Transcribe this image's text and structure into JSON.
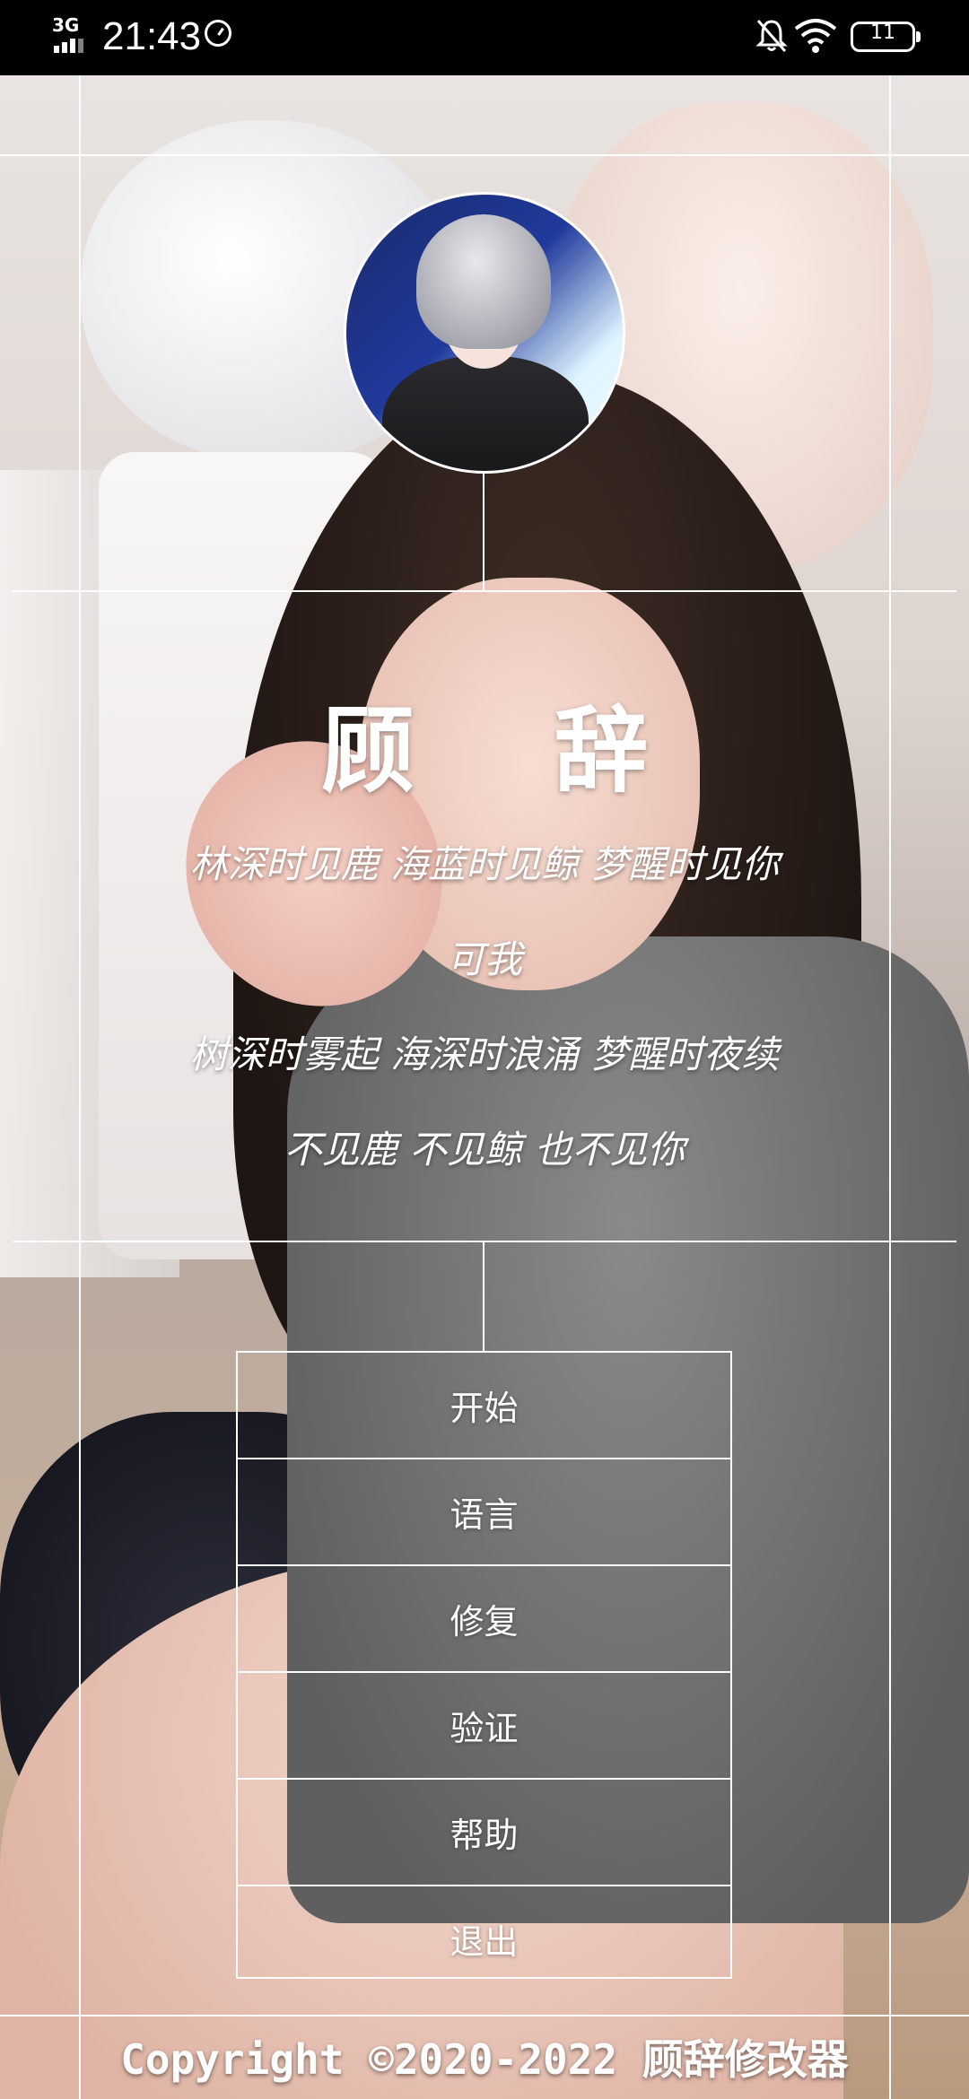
{
  "status_bar": {
    "network": "3G",
    "time": "21:43",
    "battery": "11",
    "icons": [
      "signal-icon",
      "clock-icon",
      "mute-icon",
      "wifi-icon",
      "battery-icon"
    ]
  },
  "header": {
    "avatar": "avatar"
  },
  "title": "顾 辞",
  "poem": [
    "林深时见鹿  海蓝时见鲸  梦醒时见你",
    "可我",
    "树深时雾起  海深时浪涌  梦醒时夜续",
    "不见鹿  不见鲸  也不见你"
  ],
  "menu": {
    "items": [
      {
        "label": "开始"
      },
      {
        "label": "语言"
      },
      {
        "label": "修复"
      },
      {
        "label": "验证"
      },
      {
        "label": "帮助"
      },
      {
        "label": "退出"
      }
    ]
  },
  "footer": {
    "copyright": "Copyright ©2020-2022 顾辞修改器"
  },
  "colors": {
    "line": "#ffffff",
    "text": "#ffffff",
    "status_bar_bg": "#000000"
  }
}
